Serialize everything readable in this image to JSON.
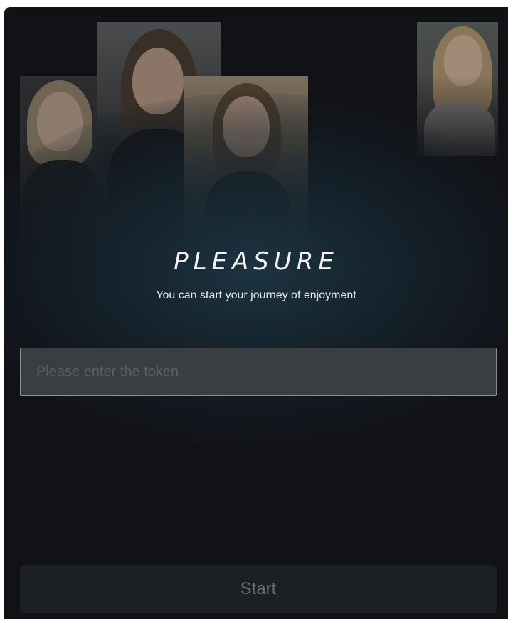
{
  "app": {
    "title": "PLEASURE",
    "subtitle": "You can start your journey of enjoyment"
  },
  "token_input": {
    "placeholder": "Please enter the token",
    "value": ""
  },
  "start_button": {
    "label": "Start"
  },
  "colors": {
    "background": "#111216",
    "input_background": "#3a3e43",
    "input_border": "#8a9096",
    "button_background": "#1c1f23",
    "button_text": "#6a6e73",
    "title_text": "#f2f2f2"
  }
}
